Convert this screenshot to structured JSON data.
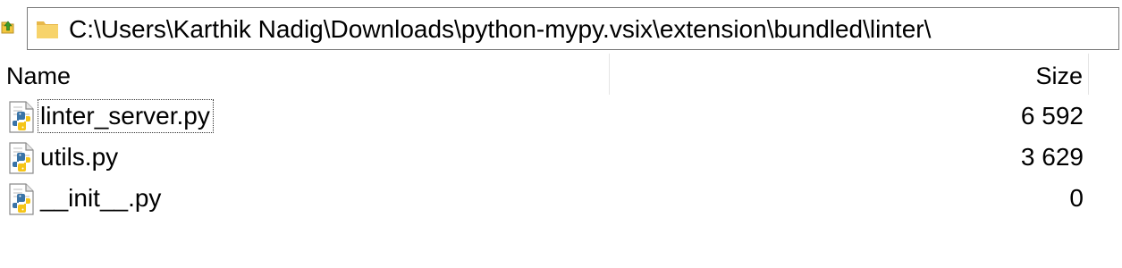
{
  "address_bar": {
    "path": "C:\\Users\\Karthik Nadig\\Downloads\\python-mypy.vsix\\extension\\bundled\\linter\\",
    "up_icon": "up-folder-arrow-icon",
    "folder_icon": "folder-icon"
  },
  "columns": {
    "name": "Name",
    "size": "Size"
  },
  "files": [
    {
      "name": "linter_server.py",
      "size": "6 592",
      "icon": "python-file-icon",
      "focused": true
    },
    {
      "name": "utils.py",
      "size": "3 629",
      "icon": "python-file-icon",
      "focused": false
    },
    {
      "name": "__init__.py",
      "size": "0",
      "icon": "python-file-icon",
      "focused": false
    }
  ],
  "colors": {
    "python_blue": "#3a74a7",
    "python_yellow": "#f5c518",
    "folder_yellow": "#f3c63f",
    "up_arrow_green": "#3a9a2a"
  }
}
